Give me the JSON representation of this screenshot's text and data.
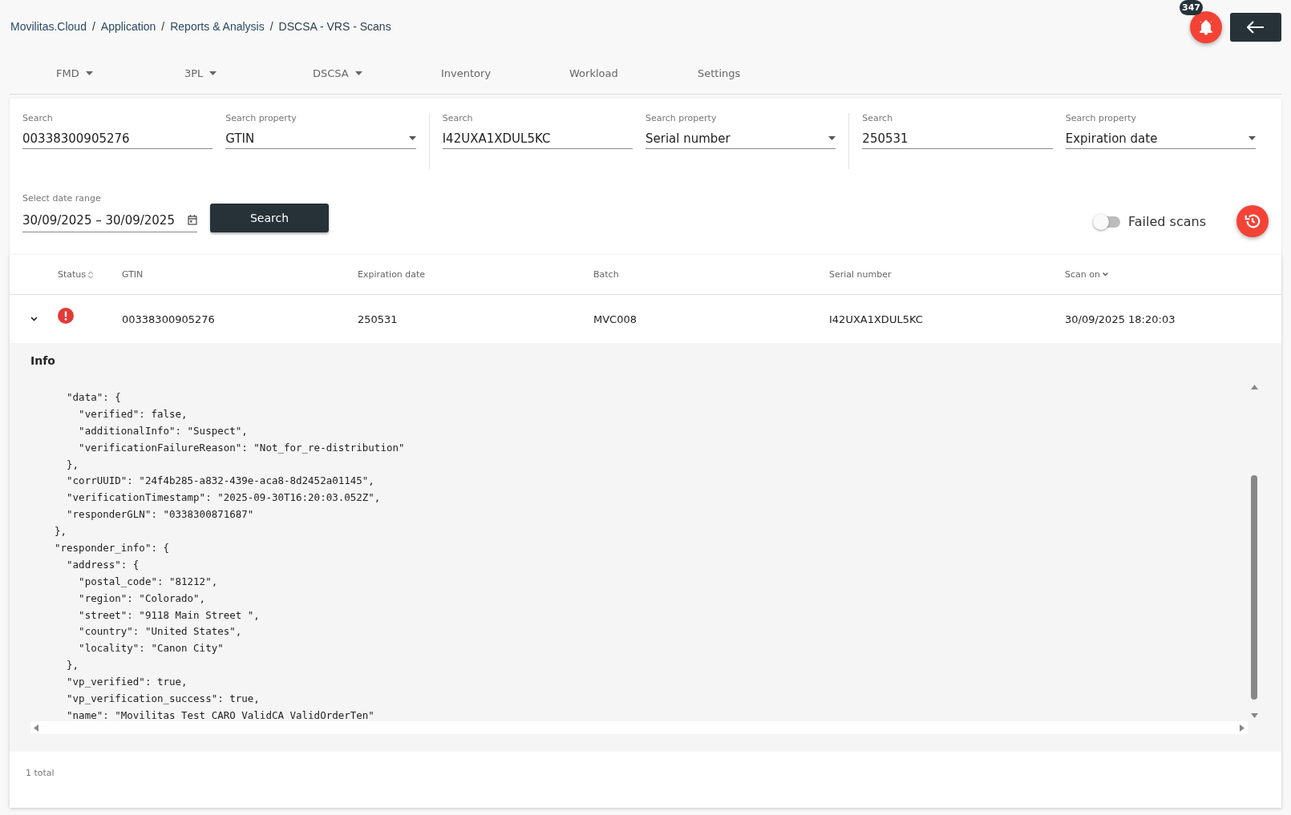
{
  "breadcrumb": [
    "Movilitas.Cloud",
    "Application",
    "Reports & Analysis",
    "DSCSA - VRS - Scans"
  ],
  "breadcrumb_separator": "/",
  "notifications": {
    "count": "347"
  },
  "nav": [
    {
      "label": "FMD",
      "dropdown": true
    },
    {
      "label": "3PL",
      "dropdown": true
    },
    {
      "label": "DSCSA",
      "dropdown": true
    },
    {
      "label": "Inventory",
      "dropdown": false
    },
    {
      "label": "Workload",
      "dropdown": false
    },
    {
      "label": "Settings",
      "dropdown": false
    }
  ],
  "filters": [
    {
      "search_label": "Search",
      "search_value": "00338300905276",
      "property_label": "Search property",
      "property_value": "GTIN"
    },
    {
      "search_label": "Search",
      "search_value": "I42UXA1XDUL5KC",
      "property_label": "Search property",
      "property_value": "Serial number"
    },
    {
      "search_label": "Search",
      "search_value": "250531",
      "property_label": "Search property",
      "property_value": "Expiration date"
    }
  ],
  "date_range": {
    "label": "Select date range",
    "value": "30/09/2025 – 30/09/2025"
  },
  "search_button": "Search",
  "failed_scans": {
    "label": "Failed scans",
    "on": false
  },
  "table": {
    "columns": [
      {
        "label": "Status",
        "sortable": true,
        "sorted": false
      },
      {
        "label": "GTIN",
        "sortable": false
      },
      {
        "label": "Expiration date",
        "sortable": false
      },
      {
        "label": "Batch",
        "sortable": false
      },
      {
        "label": "Serial number",
        "sortable": false
      },
      {
        "label": "Scan on",
        "sortable": true,
        "sorted": true
      }
    ],
    "rows": [
      {
        "expanded": true,
        "failed": true,
        "cells": [
          "",
          "00338300905276",
          "250531",
          "MVC008",
          "I42UXA1XDUL5KC",
          "30/09/2025 18:20:03"
        ]
      }
    ]
  },
  "info": {
    "title": "Info",
    "code_lines": [
      "  \"data\": {",
      "    \"verified\": false,",
      "    \"additionalInfo\": \"Suspect\",",
      "    \"verificationFailureReason\": \"Not_for_re-distribution\"",
      "  },",
      "  \"corrUUID\": \"24f4b285-a832-439e-aca8-8d2452a01145\",",
      "  \"verificationTimestamp\": \"2025-09-30T16:20:03.052Z\",",
      "  \"responderGLN\": \"0338300871687\"",
      "},",
      "\"responder_info\": {",
      "  \"address\": {",
      "    \"postal_code\": \"81212\",",
      "    \"region\": \"Colorado\",",
      "    \"street\": \"9118 Main Street \",",
      "    \"country\": \"United States\",",
      "    \"locality\": \"Canon City\"",
      "  },",
      "  \"vp_verified\": true,",
      "  \"vp_verification_success\": true,",
      "  \"name\": \"Movilitas Test CARO ValidCA ValidOrderTen\""
    ]
  },
  "total": "1 total"
}
